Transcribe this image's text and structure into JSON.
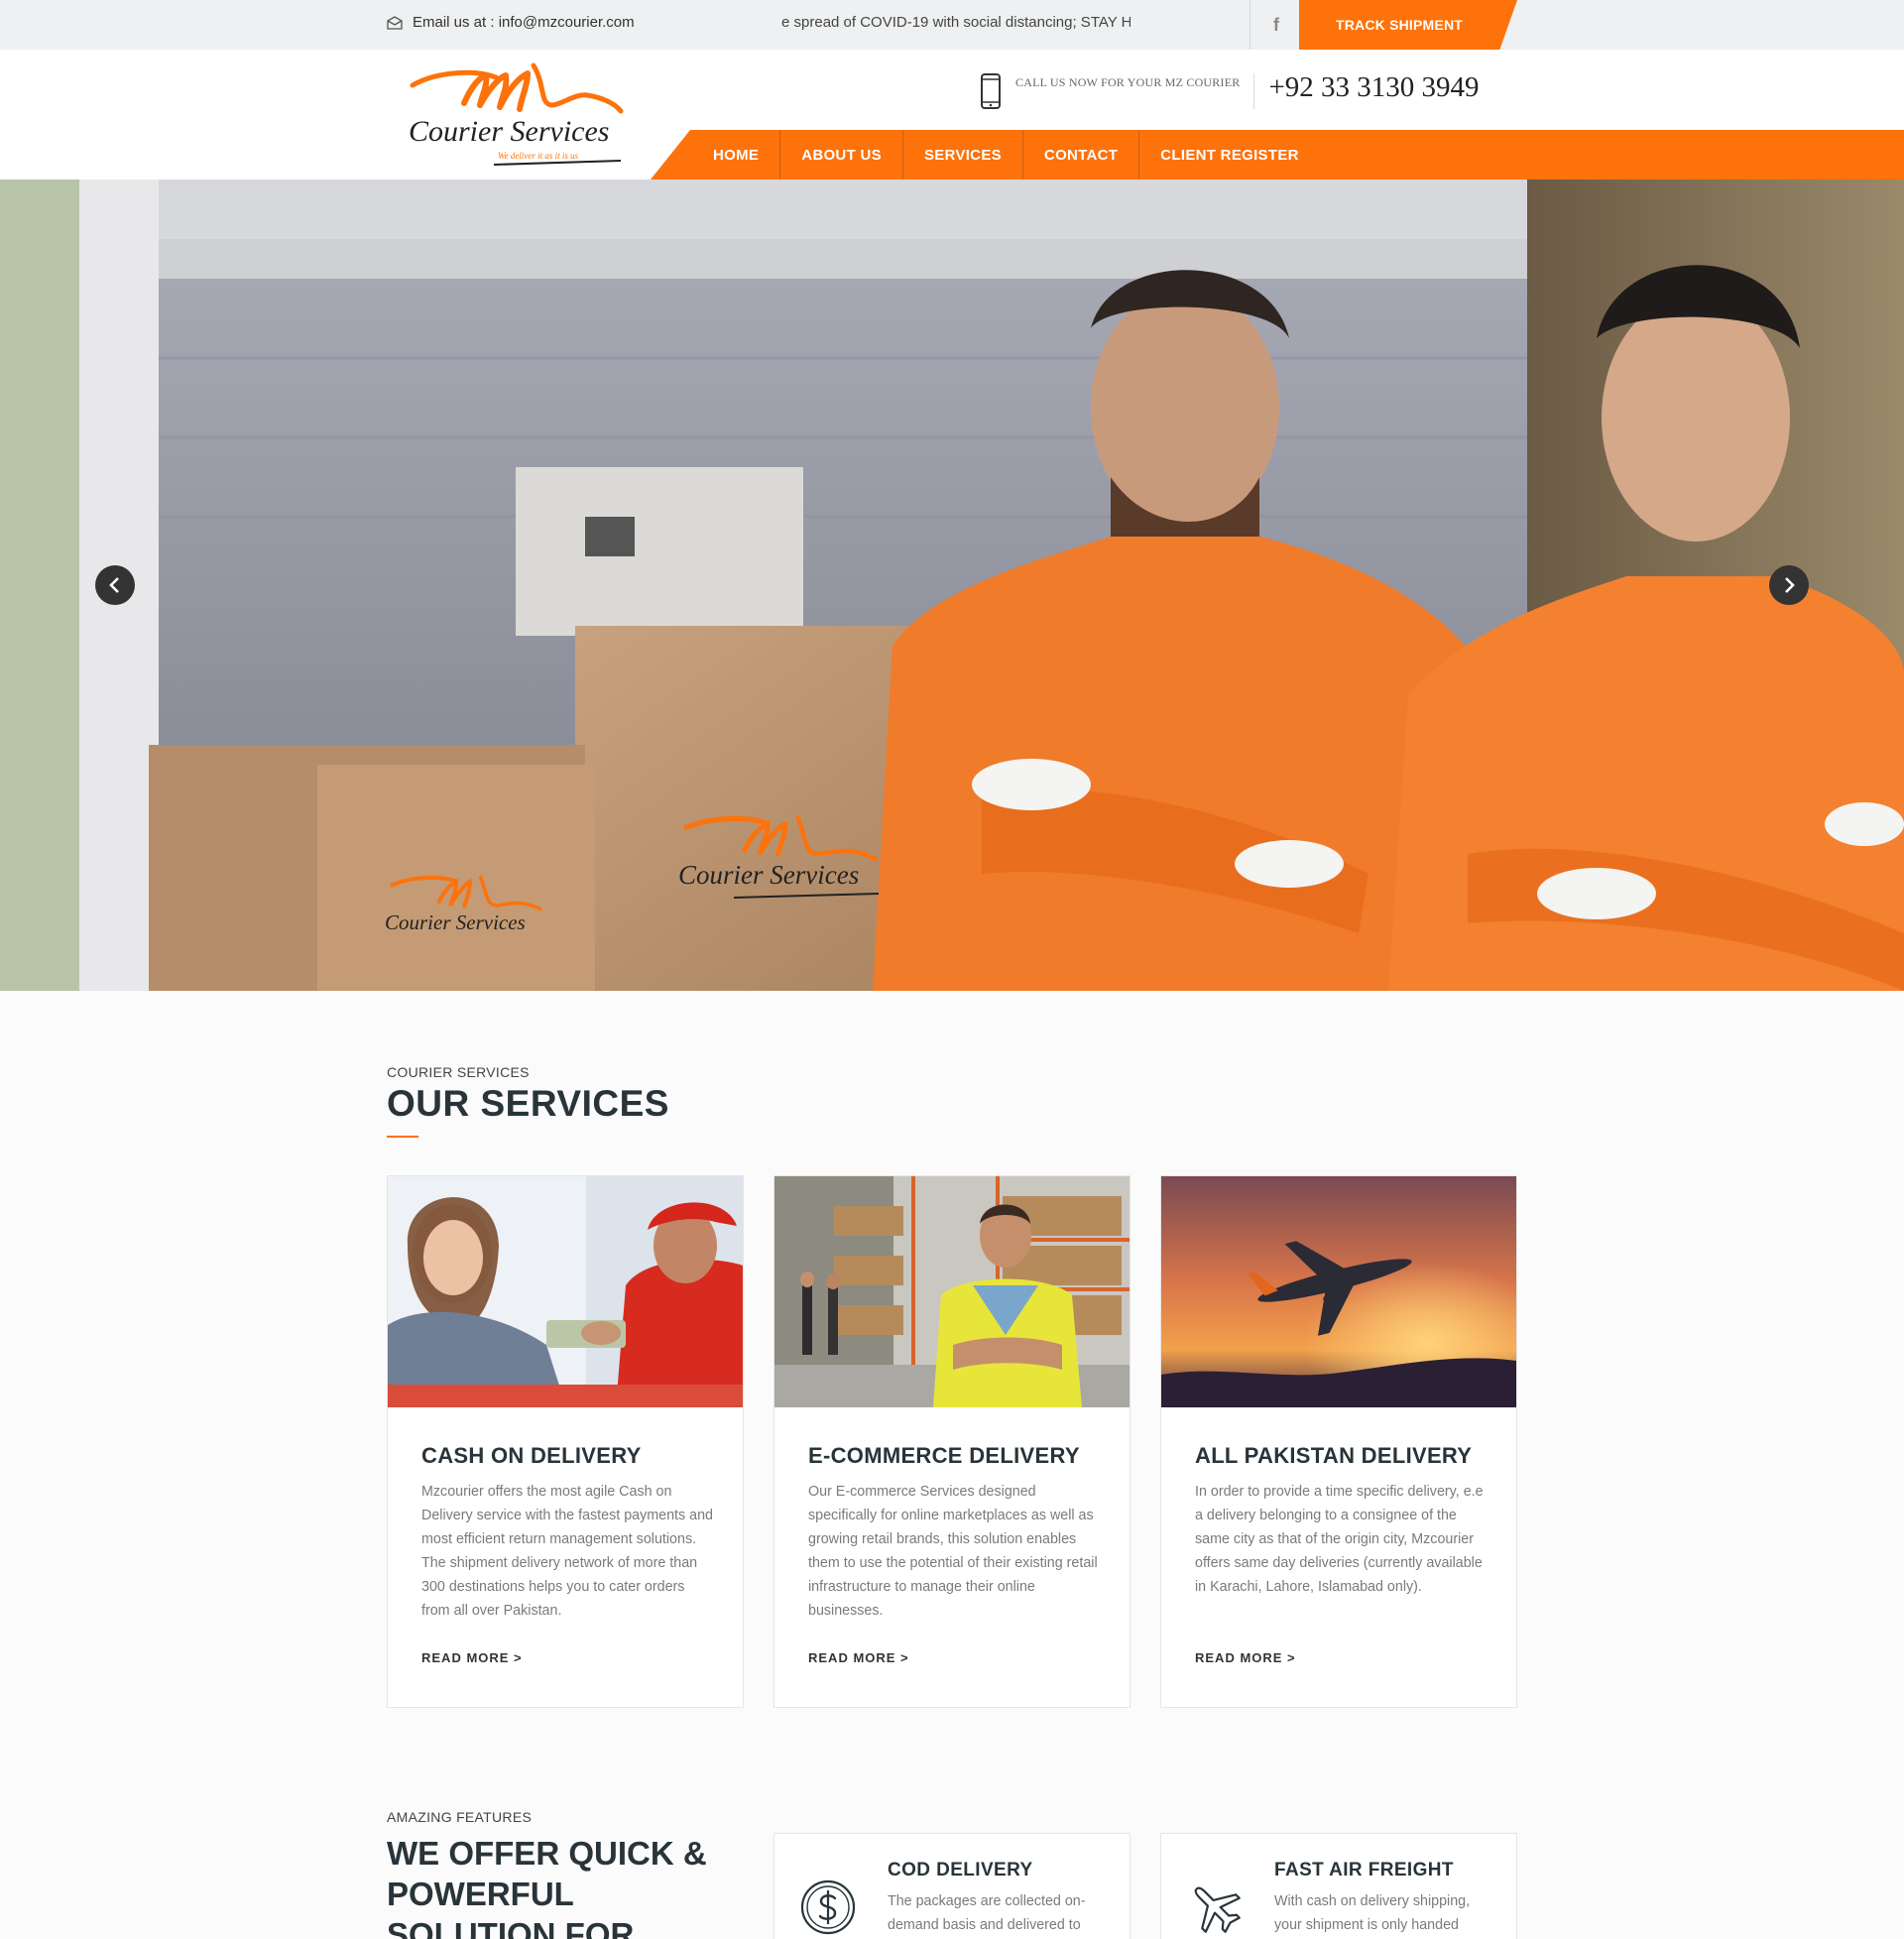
{
  "topbar": {
    "email_label": "Email us at : info@mzcourier.com",
    "marquee_text": "e spread of COVID-19 with social distancing; STAY H",
    "facebook_icon": "f",
    "track_label": "TRACK SHIPMENT"
  },
  "header": {
    "logo_brand": "Courier Services",
    "logo_tagline": "We deliver it as it is us",
    "call_text": "CALL US NOW FOR YOUR MZ COURIER",
    "phone": "+92 33 3130 3949"
  },
  "nav": {
    "items": [
      {
        "label": "HOME"
      },
      {
        "label": "ABOUT US"
      },
      {
        "label": "SERVICES"
      },
      {
        "label": "CONTACT"
      },
      {
        "label": "CLIENT REGISTER"
      }
    ]
  },
  "hero": {
    "box_logo_text": "Courier Services"
  },
  "services": {
    "kicker": "COURIER SERVICES",
    "title": "OUR SERVICES",
    "cards": [
      {
        "title": "CASH ON DELIVERY",
        "text": "Mzcourier offers the most agile Cash on Delivery service with the fastest payments and most efficient return management solutions. The shipment delivery network of more than 300 destinations helps you to cater orders from all over Pakistan.",
        "more": "READ MORE  >"
      },
      {
        "title": "E-COMMERCE DELIVERY",
        "text": "Our E-commerce Services designed specifically for online marketplaces as well as growing retail brands, this solution enables them to use the potential of their existing retail infrastructure to manage their online businesses.",
        "more": "READ MORE  >"
      },
      {
        "title": "ALL PAKISTAN DELIVERY",
        "text": "In order to provide a time specific delivery, e.e a delivery belonging to a consignee of the same city as that of the origin city, Mzcourier offers same day deliveries (currently available in Karachi, Lahore, Islamabad only).",
        "more": "READ MORE  >"
      }
    ]
  },
  "features": {
    "kicker": "AMAZING FEATURES",
    "title": "WE OFFER QUICK & POWERFUL SOLUTION FOR",
    "items": [
      {
        "title": "COD DELIVERY",
        "text": "The packages are collected on-demand basis and delivered to",
        "icon": "dollar-circle-icon"
      },
      {
        "title": "FAST AIR FREIGHT",
        "text": "With cash on delivery shipping, your shipment is only handed",
        "icon": "airplane-icon"
      }
    ]
  },
  "colors": {
    "accent": "#fd720b",
    "heading": "#283439"
  }
}
